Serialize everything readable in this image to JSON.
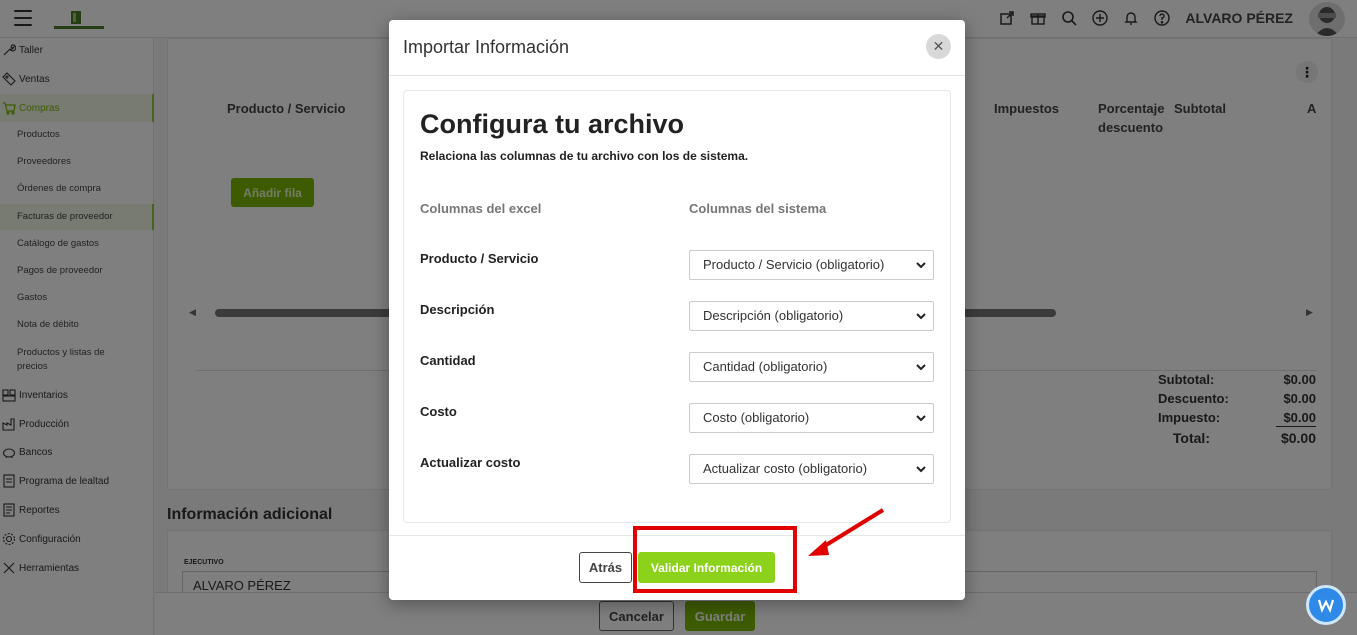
{
  "header": {
    "user_name": "ALVARO PÉREZ",
    "icons": [
      "external-link-icon",
      "gift-icon",
      "zoom-icon",
      "plus-circle-icon",
      "bell-icon",
      "help-icon"
    ]
  },
  "sidebar": {
    "items": [
      {
        "label": "Taller",
        "icon": "wrench-icon"
      },
      {
        "label": "Ventas",
        "icon": "tag-icon"
      },
      {
        "label": "Compras",
        "icon": "cart-icon",
        "active": true
      },
      {
        "label": "Inventarios",
        "icon": "boxes-icon"
      },
      {
        "label": "Producción",
        "icon": "factory-icon"
      },
      {
        "label": "Bancos",
        "icon": "piggy-bank-icon"
      },
      {
        "label": "Programa de lealtad",
        "icon": "loyalty-icon"
      },
      {
        "label": "Reportes",
        "icon": "report-icon"
      },
      {
        "label": "Configuración",
        "icon": "gear-icon"
      },
      {
        "label": "Herramientas",
        "icon": "tools-icon"
      }
    ],
    "compras_sub": [
      "Productos",
      "Proveedores",
      "Órdenes de compra",
      "Facturas de proveedor",
      "Catálogo de gastos",
      "Pagos de proveedor",
      "Gastos",
      "Nota de débito",
      "Productos y listas de precios"
    ]
  },
  "table": {
    "headers": {
      "producto": "Producto / Servicio",
      "impuestos": "Impuestos",
      "porcentaje": "Porcentaje descuento",
      "subtotal": "Subtotal",
      "a": "A"
    },
    "add_row": "Añadir fila"
  },
  "totals": {
    "subtotal_label": "Subtotal:",
    "subtotal": "$0.00",
    "descuento_label": "Descuento:",
    "descuento": "$0.00",
    "impuesto_label": "Impuesto:",
    "impuesto": "$0.00",
    "total_label": "Total:",
    "total": "$0.00"
  },
  "additional": {
    "title": "Información adicional",
    "executive_label": "EJECUTIVO",
    "executive_value": "ALVARO PÉREZ"
  },
  "footer": {
    "cancel": "Cancelar",
    "save": "Guardar"
  },
  "modal": {
    "title": "Importar Información",
    "heading": "Configura tu archivo",
    "subheading": "Relaciona las columnas de tu archivo con los de sistema.",
    "col_excel": "Columnas del excel",
    "col_system": "Columnas del sistema",
    "rows": [
      {
        "label": "Producto / Servicio",
        "selected": "Producto / Servicio (obligatorio)"
      },
      {
        "label": "Descripción",
        "selected": "Descripción (obligatorio)"
      },
      {
        "label": "Cantidad",
        "selected": "Cantidad (obligatorio)"
      },
      {
        "label": "Costo",
        "selected": "Costo (obligatorio)"
      },
      {
        "label": "Actualizar costo",
        "selected": "Actualizar costo (obligatorio)"
      }
    ],
    "back": "Atrás",
    "validate": "Validar Información"
  },
  "colors": {
    "accent": "#7ab800",
    "validate": "#8cd11a",
    "annotation": "#e00000"
  }
}
